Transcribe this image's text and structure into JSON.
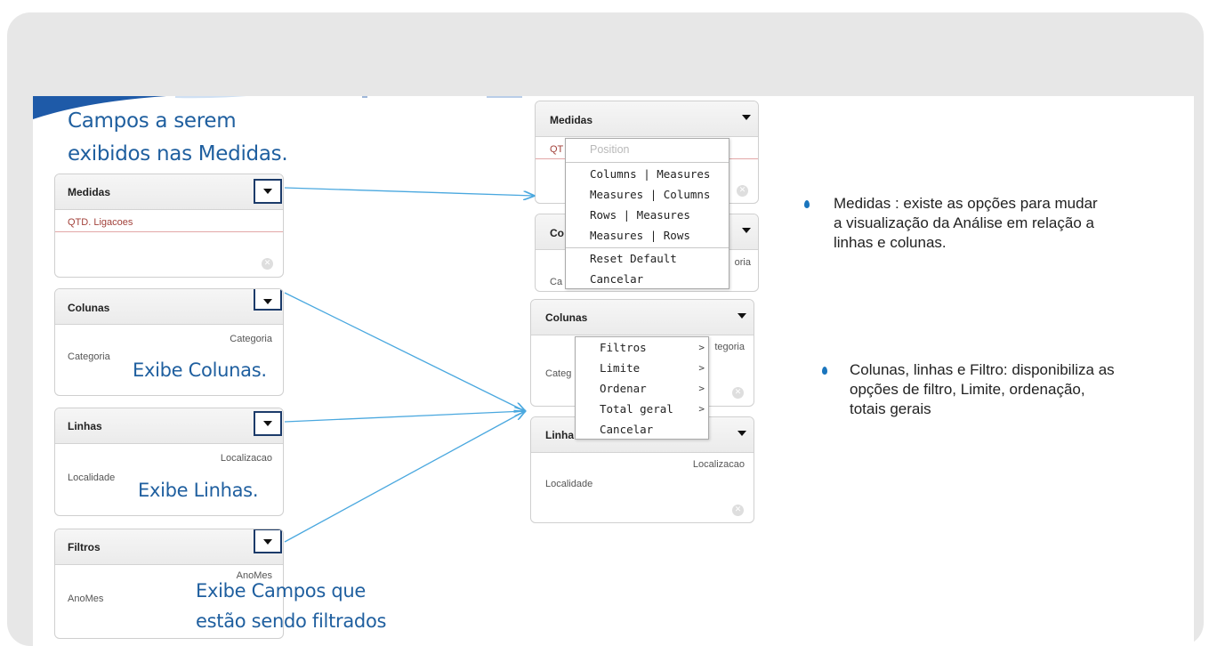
{
  "annotations": {
    "measures_title_line1": "Campos a serem",
    "measures_title_line2": "exibidos  nas Medidas.",
    "columns": "Exibe Colunas.",
    "rows": "Exibe Linhas.",
    "filters_line1": "Exibe Campos que",
    "filters_line2": "estão sendo filtrados"
  },
  "left_panels": {
    "medidas": {
      "title": "Medidas",
      "item": "QTD. Ligacoes"
    },
    "colunas": {
      "title": "Colunas",
      "header_field": "Categoria",
      "row_field": "Categoria"
    },
    "linhas": {
      "title": "Linhas",
      "header_field": "Localizacao",
      "row_field": "Localidade"
    },
    "filtros": {
      "title": "Filtros",
      "header_field": "AnoMes",
      "row_field": "AnoMes"
    }
  },
  "right_panels": {
    "medidas": {
      "title": "Medidas",
      "item_partial": "QT"
    },
    "co": {
      "title_partial": "Co",
      "header_partial": "oria",
      "row_partial": "Ca"
    },
    "colunas": {
      "title": "Colunas",
      "header_partial": "tegoria",
      "row_partial": "Categ"
    },
    "linhas": {
      "title_partial": "Linha",
      "header_field": "Localizacao",
      "row_field": "Localidade"
    }
  },
  "position_menu": {
    "header": "Position",
    "items": [
      "Columns | Measures",
      "Measures | Columns",
      "Rows | Measures",
      "Measures | Rows"
    ],
    "footer_items": [
      "Reset Default",
      "Cancelar"
    ]
  },
  "filter_menu": {
    "items": [
      {
        "label": "Filtros",
        "arrow": ">"
      },
      {
        "label": "Limite",
        "arrow": ">"
      },
      {
        "label": "Ordenar",
        "arrow": ">"
      },
      {
        "label": "Total geral",
        "arrow": ">"
      },
      {
        "label": "Cancelar",
        "arrow": ""
      }
    ]
  },
  "descriptions": {
    "medidas": [
      "Medidas : existe as opções para mudar",
      "a visualização da Análise em relação a",
      "linhas e colunas."
    ],
    "colunas": [
      "Colunas, linhas e Filtro: disponibiliza as",
      "opções de filtro, Limite, ordenação,",
      "totais gerais"
    ]
  },
  "colors": {
    "annotation_blue": "#1f5f9f",
    "arrow_blue": "#4aa8df",
    "bullet_blue": "#1a75bd",
    "measure_red": "#a2413a"
  }
}
